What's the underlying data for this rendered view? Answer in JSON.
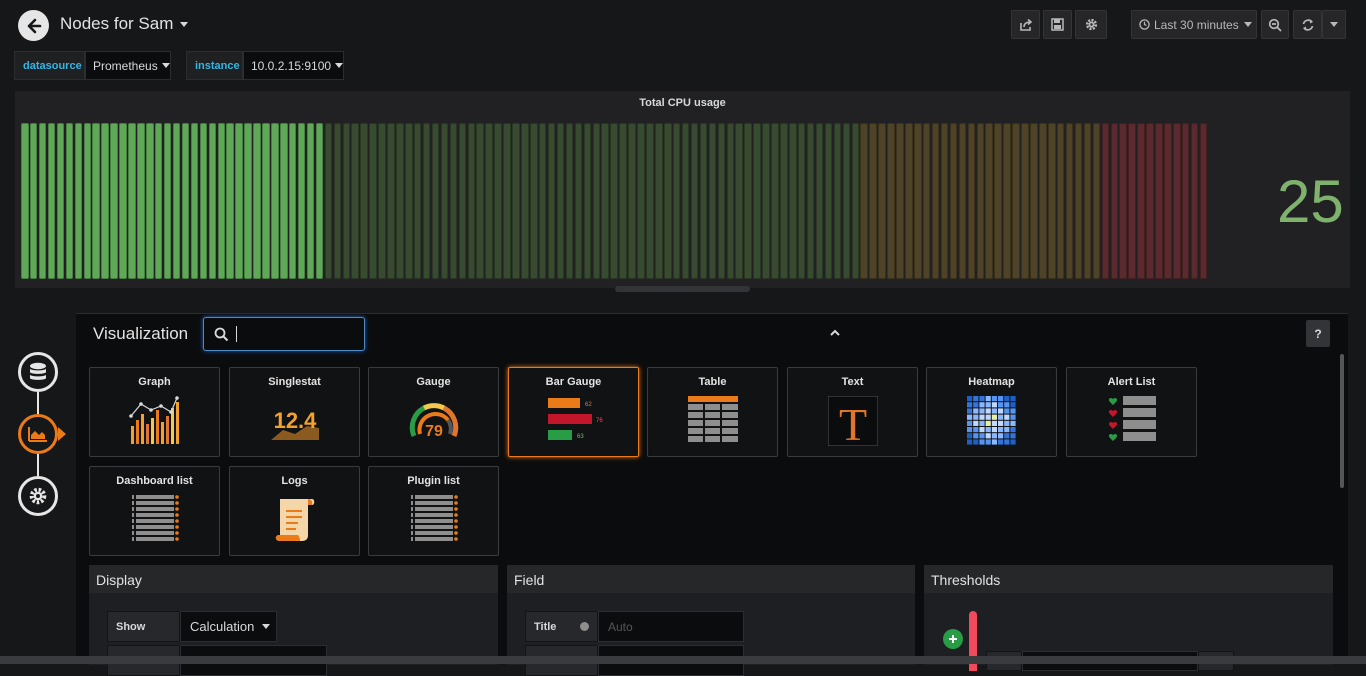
{
  "header": {
    "title": "Nodes for Sam",
    "time_range": "Last 30 minutes"
  },
  "variables": [
    {
      "label": "datasource",
      "value": "Prometheus"
    },
    {
      "label": "instance",
      "value": "10.0.2.15:9100"
    }
  ],
  "panel": {
    "title": "Total CPU usage",
    "value": "25",
    "value_color": "#7eb26d"
  },
  "editor": {
    "section_title": "Visualization",
    "search_value": "",
    "help_label": "?",
    "viz_types": [
      {
        "name": "Graph",
        "icon": "graph-icon"
      },
      {
        "name": "Singlestat",
        "icon": "singlestat-icon",
        "sample": "12.4"
      },
      {
        "name": "Gauge",
        "icon": "gauge-icon",
        "sample": "79"
      },
      {
        "name": "Bar Gauge",
        "icon": "bar-gauge-icon",
        "selected": true,
        "samples": [
          "62",
          "76",
          "63"
        ]
      },
      {
        "name": "Table",
        "icon": "table-icon"
      },
      {
        "name": "Text",
        "icon": "text-icon",
        "sample": "T"
      },
      {
        "name": "Heatmap",
        "icon": "heatmap-icon"
      },
      {
        "name": "Alert List",
        "icon": "alert-list-icon"
      },
      {
        "name": "Dashboard list",
        "icon": "dashboard-list-icon"
      },
      {
        "name": "Logs",
        "icon": "logs-icon"
      },
      {
        "name": "Plugin list",
        "icon": "plugin-list-icon"
      }
    ]
  },
  "options": {
    "display": {
      "title": "Display",
      "show_label": "Show",
      "show_value": "Calculation"
    },
    "field": {
      "title": "Field",
      "title_label": "Title",
      "title_placeholder": "Auto"
    },
    "thresholds": {
      "title": "Thresholds"
    }
  },
  "colors": {
    "accent": "#eb7b18",
    "green": "#73bf69",
    "threshold_red": "#f2495c",
    "add_green": "#299c46"
  }
}
